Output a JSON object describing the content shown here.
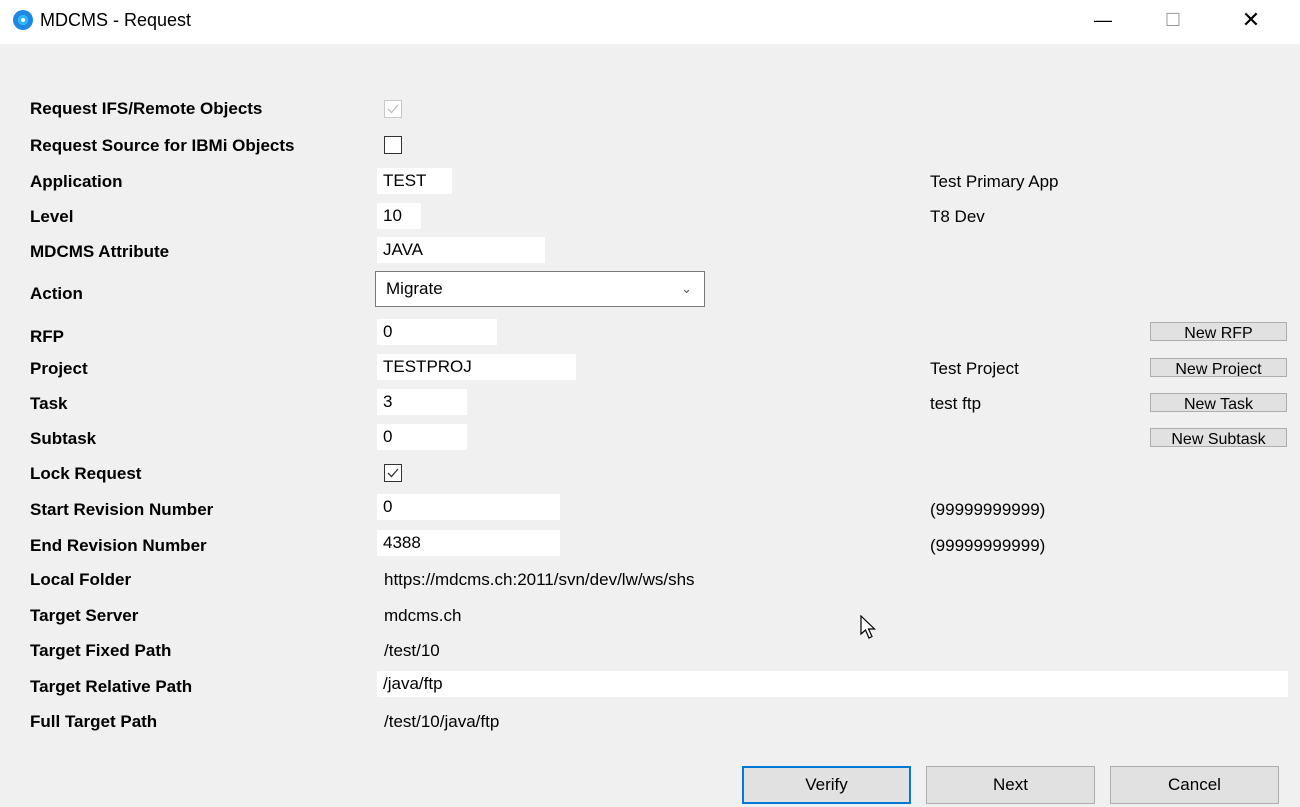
{
  "window": {
    "title": "MDCMS - Request",
    "icon": "mdcms-logo-icon",
    "controls": {
      "minimize": "—",
      "maximize": "☐",
      "close": "✕"
    }
  },
  "form": {
    "request_ifs_label": "Request IFS/Remote Objects",
    "request_ifs_checked": true,
    "request_source_label": "Request Source for IBMi Objects",
    "request_source_checked": false,
    "application_label": "Application",
    "application_value": "TEST",
    "application_desc": "Test Primary App",
    "level_label": "Level",
    "level_value": "10",
    "level_desc": "T8 Dev",
    "attribute_label": "MDCMS Attribute",
    "attribute_value": "JAVA",
    "action_label": "Action",
    "action_value": "Migrate",
    "rfp_label": "RFP",
    "rfp_value": "0",
    "project_label": "Project",
    "project_value": "TESTPROJ",
    "project_desc": "Test Project",
    "task_label": "Task",
    "task_value": "3",
    "task_desc": "test ftp",
    "subtask_label": "Subtask",
    "subtask_value": "0",
    "lock_label": "Lock Request",
    "lock_checked": true,
    "start_rev_label": "Start Revision Number",
    "start_rev_value": "0",
    "start_rev_hint": "(99999999999)",
    "end_rev_label": "End Revision Number",
    "end_rev_value": "4388",
    "end_rev_hint": "(99999999999)",
    "local_folder_label": "Local Folder",
    "local_folder_value": "https://mdcms.ch:2011/svn/dev/lw/ws/shs",
    "target_server_label": "Target Server",
    "target_server_value": "mdcms.ch",
    "target_fixed_label": "Target Fixed Path",
    "target_fixed_value": "/test/10",
    "target_relative_label": "Target Relative Path",
    "target_relative_value": "/java/ftp",
    "full_target_label": "Full Target Path",
    "full_target_value": "/test/10/java/ftp"
  },
  "side_buttons": {
    "new_rfp": "New RFP",
    "new_project": "New Project",
    "new_task": "New Task",
    "new_subtask": "New Subtask"
  },
  "buttons": {
    "verify": "Verify",
    "next": "Next",
    "cancel": "Cancel"
  }
}
